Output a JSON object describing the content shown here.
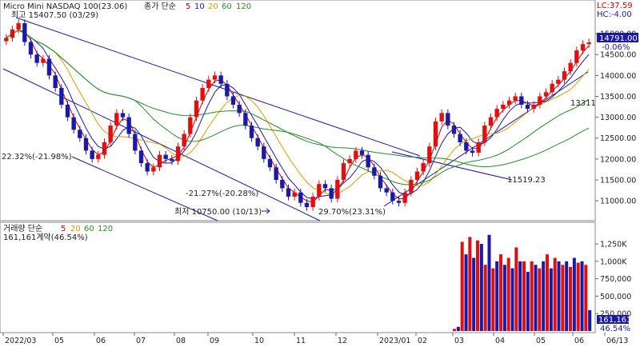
{
  "chart_data": [
    {
      "type": "candlestick",
      "title": "Micro Mini NASDAQ 100(23.06)",
      "legend": {
        "label": "종가 단순",
        "periods": [
          "5",
          "10",
          "20",
          "60",
          "120"
        ],
        "colors": [
          "#d40000",
          "#1a1aa6",
          "#d4a000",
          "#2a8a2a",
          "#2a8a2a"
        ]
      },
      "price_axis": {
        "ticks": [
          "15000.00",
          "14500.00",
          "14000.00",
          "13500.00",
          "13000.00",
          "12500.00",
          "12000.00",
          "11500.00",
          "11000.00"
        ],
        "ylim": [
          10600,
          15500
        ]
      },
      "last_price": "14791.00",
      "last_change": "-0.06%",
      "lc": "LC:37.59",
      "hc": "HC:-4.00",
      "annotations": {
        "high": "최고 15407.50 (03/29)",
        "low": "최저 10750.00 (10/13)",
        "drop1": "22.32%(-21.98%)",
        "drop2": "-21.27%(-20.28%)",
        "rise": "29.70%(23.31%)",
        "trend1": "11519.23",
        "trend2": "13311"
      },
      "x_labels": [
        "2022/03",
        "05",
        "06",
        "07",
        "08",
        "09",
        "10",
        "11",
        "12",
        "2023/01",
        "02",
        "03",
        "04",
        "05",
        "06",
        "06/13"
      ],
      "closes": [
        14900,
        15100,
        15250,
        14800,
        14500,
        14300,
        14400,
        14000,
        13700,
        13300,
        13000,
        12700,
        12500,
        12200,
        12000,
        12100,
        12400,
        12800,
        13100,
        13000,
        12600,
        12200,
        11900,
        11700,
        11800,
        12100,
        12000,
        11950,
        12300,
        12600,
        13000,
        13400,
        13700,
        13900,
        14000,
        13800,
        13500,
        13300,
        13100,
        12800,
        12500,
        12300,
        12000,
        11800,
        11500,
        11300,
        11100,
        11200,
        10950,
        10850,
        11100,
        11400,
        11300,
        11050,
        11500,
        11900,
        12000,
        12200,
        12100,
        11800,
        11600,
        11300,
        11200,
        11000,
        10950,
        11200,
        11500,
        11700,
        11900,
        12300,
        12900,
        13100,
        12800,
        12600,
        12400,
        12200,
        12150,
        12400,
        12800,
        13000,
        13200,
        13300,
        13400,
        13500,
        13300,
        13200,
        13300,
        13500,
        13600,
        13800,
        13900,
        14100,
        14300,
        14600,
        14750,
        14791
      ]
    },
    {
      "type": "bar",
      "title": "거래량 단순",
      "legend": {
        "periods": [
          "5",
          "20",
          "60",
          "120"
        ]
      },
      "value_label": "161,161계약(46.54%)",
      "last_value": "161,161",
      "last_pct": "46.54%",
      "axis_ticks": [
        "1,250K",
        "1,000K",
        "750,000",
        "500,000",
        "250,000"
      ],
      "ylim": [
        0,
        1400000
      ],
      "volumes": [
        30000,
        60000,
        1280000,
        1100000,
        1350000,
        1050000,
        1300000,
        1250000,
        950000,
        1380000,
        900000,
        1000000,
        1100000,
        950000,
        1050000,
        900000,
        1200000,
        1000000,
        1000000,
        850000,
        1000000,
        950000,
        900000,
        1000000,
        1100000,
        900000,
        1050000,
        1000000,
        950000,
        1000000,
        920000,
        1050000,
        980000,
        1000000,
        950000,
        300000
      ]
    }
  ]
}
